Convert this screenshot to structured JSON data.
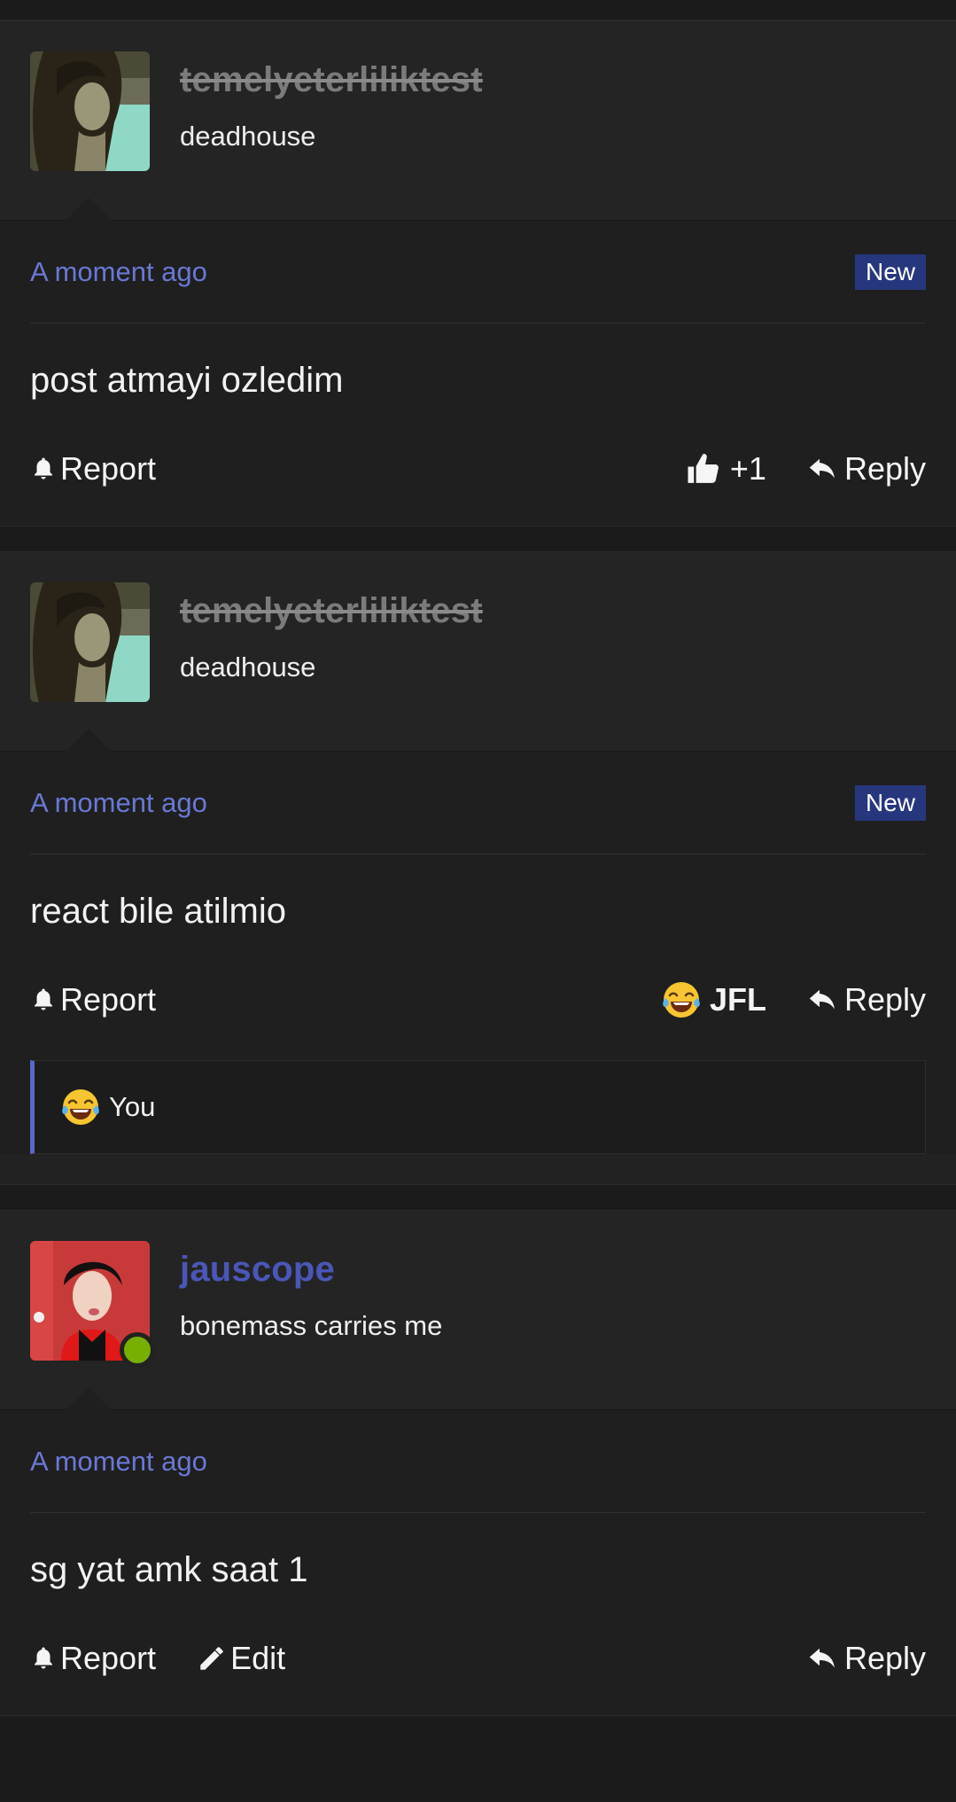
{
  "colors": {
    "background": "#1b1b1b",
    "card": "#222222",
    "link": "#6a78d4",
    "username_active": "#4a56b8",
    "badge_new": "#27377e",
    "online": "#78b000"
  },
  "icons": {
    "report": "bell-icon",
    "reply": "reply-arrow-icon",
    "edit": "pencil-icon",
    "like": "thumbs-up-icon",
    "reaction": "laughing-crying-emoji-icon"
  },
  "posts": [
    {
      "username": "temelyeterliliktest",
      "user_title": "deadhouse",
      "timestamp": "A moment ago",
      "badge": "New",
      "text": "post atmayi ozledim",
      "report_label": "Report",
      "like_label": "+1",
      "reply_label": "Reply"
    },
    {
      "username": "temelyeterliliktest",
      "user_title": "deadhouse",
      "timestamp": "A moment ago",
      "badge": "New",
      "text": "react bile atilmio",
      "report_label": "Report",
      "reaction_label": "JFL",
      "reply_label": "Reply",
      "reactor": "You"
    },
    {
      "username": "jauscope",
      "user_title": "bonemass carries me",
      "timestamp": "A moment ago",
      "text": "sg yat amk saat 1",
      "report_label": "Report",
      "edit_label": "Edit",
      "reply_label": "Reply"
    }
  ]
}
